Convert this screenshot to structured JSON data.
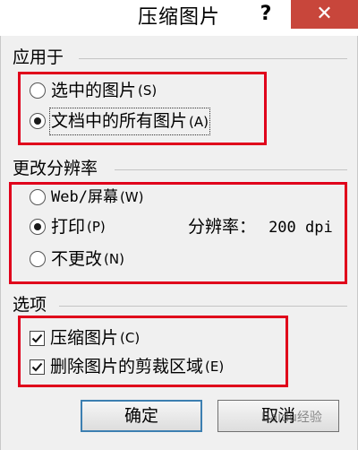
{
  "window": {
    "title": "压缩图片",
    "help_label": "?",
    "close_label": "✕"
  },
  "apply_to": {
    "label": "应用于",
    "options": [
      {
        "label": "选中的图片",
        "mnemonic": "(S)",
        "checked": false
      },
      {
        "label": "文档中的所有图片",
        "mnemonic": "(A)",
        "checked": true
      }
    ]
  },
  "resolution": {
    "label": "更改分辨率",
    "options": [
      {
        "label": "Web/屏幕",
        "mnemonic": "(W)",
        "checked": false
      },
      {
        "label": "打印",
        "mnemonic": "(P)",
        "checked": true
      },
      {
        "label": "不更改",
        "mnemonic": "(N)",
        "checked": false
      }
    ],
    "value_label": "分辨率：",
    "value": "200 dpi"
  },
  "options": {
    "label": "选项",
    "items": [
      {
        "label": "压缩图片",
        "mnemonic": "(C)",
        "checked": true
      },
      {
        "label": "删除图片的剪裁区域",
        "mnemonic": "(E)",
        "checked": true
      }
    ]
  },
  "buttons": {
    "ok": "确定",
    "cancel": "取消"
  },
  "watermark": "Baidu经验",
  "colors": {
    "highlight": "#e0001b",
    "close_button": "#c8463b"
  }
}
